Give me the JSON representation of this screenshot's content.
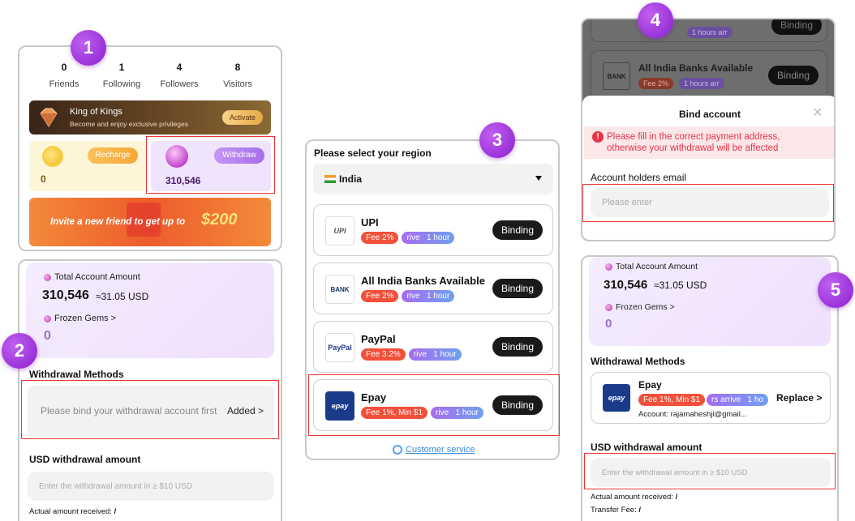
{
  "steps": [
    "1",
    "2",
    "3",
    "4",
    "5"
  ],
  "profile": {
    "stats": [
      {
        "value": "0",
        "label": "Friends"
      },
      {
        "value": "1",
        "label": "Following"
      },
      {
        "value": "4",
        "label": "Followers"
      },
      {
        "value": "8",
        "label": "Visitors"
      }
    ],
    "vip": {
      "title": "King of Kings",
      "subtitle": "Become and enjoy exclusive privileges",
      "button": "Activate"
    },
    "recharge": {
      "button": "Recharge",
      "amount": "0"
    },
    "withdraw": {
      "button": "Withdraw",
      "amount": "310,546"
    },
    "banner": {
      "text": "Invite a new friend to get up to",
      "amount": "$200"
    }
  },
  "withdrawal": {
    "total_label": "Total Account Amount",
    "total_value": "310,546",
    "total_usd": "≈31.05 USD",
    "frozen_label": "Frozen Gems >",
    "frozen_value": "0",
    "methods_label": "Withdrawal Methods",
    "bind_prompt": "Please bind your withdrawal account first",
    "added": "Added >",
    "usd_label": "USD withdrawal amount",
    "usd_placeholder": "Enter the withdrawal amount in ≥ $10 USD",
    "actual_label": "Actual amount received:",
    "actual_value": "/"
  },
  "region": {
    "title": "Please select your region",
    "country": "India",
    "methods": [
      {
        "name": "UPI",
        "fee": "Fee 2%",
        "arrive": "rive",
        "hours": "1 hour",
        "button": "Binding",
        "logo": "UPI"
      },
      {
        "name": "All India Banks Available",
        "fee": "Fee 2%",
        "arrive": "rive",
        "hours": "1 hour",
        "button": "Binding",
        "logo": "BANK"
      },
      {
        "name": "PayPal",
        "fee": "Fee 3.2%",
        "arrive": "rive",
        "hours": "1 hour",
        "button": "Binding",
        "logo": "PayPal"
      },
      {
        "name": "Epay",
        "fee": "Fee 1%, Min $1",
        "arrive": "rive",
        "hours": "1 hour",
        "button": "Binding",
        "logo": "epay"
      }
    ],
    "customer_service": "Customer service"
  },
  "bind_modal": {
    "top_item_hours": "1 hours arr",
    "top_item_button": "Binding",
    "bank_name": "All India Banks Available",
    "bank_fee": "Fee 2%",
    "bank_hours": "1 hours arr",
    "bank_button": "Binding",
    "bank_logo": "BANK",
    "title": "Bind account",
    "close": "×",
    "warning": "Please fill in the correct payment address, otherwise your withdrawal will be affected",
    "email_label": "Account holders email",
    "email_placeholder": "Please enter"
  },
  "final": {
    "total_label": "Total Account Amount",
    "total_value": "310,546",
    "total_usd": "≈31.05 USD",
    "frozen_label": "Frozen Gems >",
    "frozen_value": "0",
    "methods_label": "Withdrawal Methods",
    "method_name": "Epay",
    "method_fee": "Fee 1%, Min $1",
    "method_arrive": "rs arrive",
    "method_hours": "1 ho",
    "method_account": "Account: rajamaheshji@gmail...",
    "replace": "Replace >",
    "usd_label": "USD withdrawal amount",
    "usd_placeholder": "Enter the withdrawal amount in ≥ $10 USD",
    "actual_label": "Actual amount received:",
    "actual_value": "/",
    "fee_label": "Transfer Fee:",
    "fee_value": "/"
  }
}
